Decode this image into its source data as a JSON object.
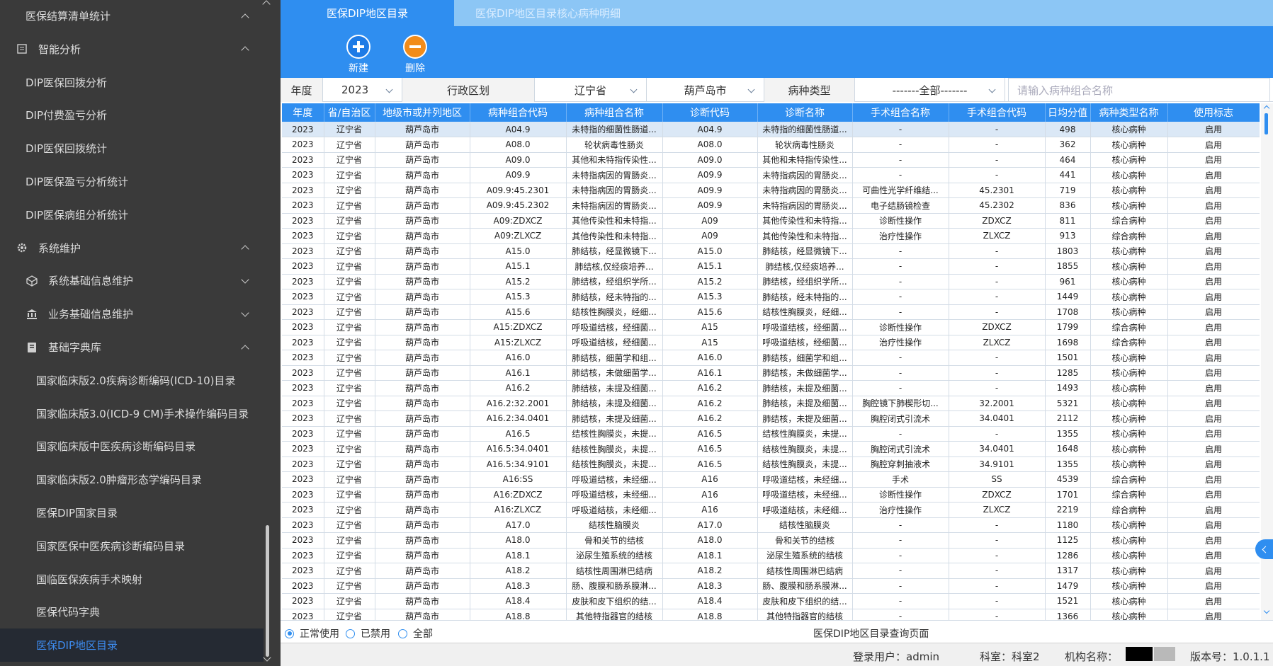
{
  "sidebar": {
    "items": [
      {
        "label": "医保结算清单统计",
        "level": 2,
        "chevron": "up"
      },
      {
        "label": "智能分析",
        "level": 1,
        "icon": "chart-doc-icon",
        "chevron": "up"
      },
      {
        "label": "DIP医保回拨分析",
        "level": 2
      },
      {
        "label": "DIP付费盈亏分析",
        "level": 2
      },
      {
        "label": "DIP医保回拨统计",
        "level": 2
      },
      {
        "label": "DIP医保盈亏分析统计",
        "level": 2
      },
      {
        "label": "DIP医保病组分析统计",
        "level": 2
      },
      {
        "label": "系统维护",
        "level": 1,
        "icon": "gear-icon",
        "chevron": "up"
      },
      {
        "label": "系统基础信息维护",
        "level": "1b",
        "icon": "cube-icon",
        "chevron": "down"
      },
      {
        "label": "业务基础信息维护",
        "level": "1b",
        "icon": "bank-icon",
        "chevron": "down"
      },
      {
        "label": "基础字典库",
        "level": "1b",
        "icon": "book-icon",
        "chevron": "up"
      },
      {
        "label": "国家临床版2.0疾病诊断编码(ICD-10)目录",
        "level": 3
      },
      {
        "label": "国家临床版3.0(ICD-9 CM)手术操作编码目录",
        "level": 3
      },
      {
        "label": "国家临床版中医疾病诊断编码目录",
        "level": 3
      },
      {
        "label": "国家临床版2.0肿瘤形态学编码目录",
        "level": 3
      },
      {
        "label": "医保DIP国家目录",
        "level": 3
      },
      {
        "label": "国家医保中医疾病诊断编码目录",
        "level": 3
      },
      {
        "label": "国临医保疾病手术映射",
        "level": 3
      },
      {
        "label": "医保代码字典",
        "level": 3
      },
      {
        "label": "医保DIP地区目录",
        "level": 3,
        "active": true
      }
    ]
  },
  "tabs": [
    {
      "label": "医保DIP地区目录",
      "active": true
    },
    {
      "label": "医保DIP地区目录核心病种明细",
      "active": false
    }
  ],
  "toolbar": {
    "new_label": "新建",
    "delete_label": "删除"
  },
  "filters": {
    "year_label": "年度",
    "year_value": "2023",
    "region_label": "行政区划",
    "province_value": "辽宁省",
    "city_value": "葫芦岛市",
    "type_label": "病种类型",
    "type_value": "-------全部-------",
    "search_placeholder": "请输入病种组合名称"
  },
  "table": {
    "headers": [
      "年度",
      "省/自治区",
      "地级市或并列地区",
      "病种组合代码",
      "病种组合名称",
      "诊断代码",
      "诊断名称",
      "手术组合名称",
      "手术组合代码",
      "日均分值",
      "病种类型名称",
      "使用标志"
    ],
    "rows": [
      [
        "2023",
        "辽宁省",
        "葫芦岛市",
        "A04.9",
        "未特指的细菌性肠道...",
        "A04.9",
        "未特指的细菌性肠道...",
        "-",
        "-",
        "498",
        "核心病种",
        "启用"
      ],
      [
        "2023",
        "辽宁省",
        "葫芦岛市",
        "A08.0",
        "轮状病毒性肠炎",
        "A08.0",
        "轮状病毒性肠炎",
        "-",
        "-",
        "362",
        "核心病种",
        "启用"
      ],
      [
        "2023",
        "辽宁省",
        "葫芦岛市",
        "A09.0",
        "其他和未特指传染性...",
        "A09.0",
        "其他和未特指传染性...",
        "-",
        "-",
        "464",
        "核心病种",
        "启用"
      ],
      [
        "2023",
        "辽宁省",
        "葫芦岛市",
        "A09.9",
        "未特指病因的胃肠炎...",
        "A09.9",
        "未特指病因的胃肠炎...",
        "-",
        "-",
        "441",
        "核心病种",
        "启用"
      ],
      [
        "2023",
        "辽宁省",
        "葫芦岛市",
        "A09.9:45.2301",
        "未特指病因的胃肠炎...",
        "A09.9",
        "未特指病因的胃肠炎...",
        "可曲性光学纤维结...",
        "45.2301",
        "719",
        "核心病种",
        "启用"
      ],
      [
        "2023",
        "辽宁省",
        "葫芦岛市",
        "A09.9:45.2302",
        "未特指病因的胃肠炎...",
        "A09.9",
        "未特指病因的胃肠炎...",
        "电子结肠镜检查",
        "45.2302",
        "836",
        "核心病种",
        "启用"
      ],
      [
        "2023",
        "辽宁省",
        "葫芦岛市",
        "A09:ZDXCZ",
        "其他传染性和未特指...",
        "A09",
        "其他传染性和未特指...",
        "诊断性操作",
        "ZDXCZ",
        "811",
        "综合病种",
        "启用"
      ],
      [
        "2023",
        "辽宁省",
        "葫芦岛市",
        "A09:ZLXCZ",
        "其他传染性和未特指...",
        "A09",
        "其他传染性和未特指...",
        "治疗性操作",
        "ZLXCZ",
        "913",
        "综合病种",
        "启用"
      ],
      [
        "2023",
        "辽宁省",
        "葫芦岛市",
        "A15.0",
        "肺结核，经显微镜下...",
        "A15.0",
        "肺结核，经显微镜下...",
        "-",
        "-",
        "1803",
        "核心病种",
        "启用"
      ],
      [
        "2023",
        "辽宁省",
        "葫芦岛市",
        "A15.1",
        "肺结核,仅经痰培养...",
        "A15.1",
        "肺结核,仅经痰培养...",
        "-",
        "-",
        "1855",
        "核心病种",
        "启用"
      ],
      [
        "2023",
        "辽宁省",
        "葫芦岛市",
        "A15.2",
        "肺结核，经组织学所...",
        "A15.2",
        "肺结核，经组织学所...",
        "-",
        "-",
        "961",
        "核心病种",
        "启用"
      ],
      [
        "2023",
        "辽宁省",
        "葫芦岛市",
        "A15.3",
        "肺结核，经未特指的...",
        "A15.3",
        "肺结核，经未特指的...",
        "-",
        "-",
        "1449",
        "核心病种",
        "启用"
      ],
      [
        "2023",
        "辽宁省",
        "葫芦岛市",
        "A15.6",
        "结核性胸膜炎，经细...",
        "A15.6",
        "结核性胸膜炎，经细...",
        "-",
        "-",
        "1708",
        "核心病种",
        "启用"
      ],
      [
        "2023",
        "辽宁省",
        "葫芦岛市",
        "A15:ZDXCZ",
        "呼吸道结核，经细菌...",
        "A15",
        "呼吸道结核，经细菌...",
        "诊断性操作",
        "ZDXCZ",
        "1799",
        "综合病种",
        "启用"
      ],
      [
        "2023",
        "辽宁省",
        "葫芦岛市",
        "A15:ZLXCZ",
        "呼吸道结核，经细菌...",
        "A15",
        "呼吸道结核，经细菌...",
        "治疗性操作",
        "ZLXCZ",
        "1698",
        "综合病种",
        "启用"
      ],
      [
        "2023",
        "辽宁省",
        "葫芦岛市",
        "A16.0",
        "肺结核，细菌学和组...",
        "A16.0",
        "肺结核，细菌学和组...",
        "-",
        "-",
        "1501",
        "核心病种",
        "启用"
      ],
      [
        "2023",
        "辽宁省",
        "葫芦岛市",
        "A16.1",
        "肺结核，未做细菌学...",
        "A16.1",
        "肺结核，未做细菌学...",
        "-",
        "-",
        "1285",
        "核心病种",
        "启用"
      ],
      [
        "2023",
        "辽宁省",
        "葫芦岛市",
        "A16.2",
        "肺结核，未提及细菌...",
        "A16.2",
        "肺结核，未提及细菌...",
        "-",
        "-",
        "1493",
        "核心病种",
        "启用"
      ],
      [
        "2023",
        "辽宁省",
        "葫芦岛市",
        "A16.2:32.2001",
        "肺结核，未提及细菌...",
        "A16.2",
        "肺结核，未提及细菌...",
        "胸腔镜下肺楔形切...",
        "32.2001",
        "5321",
        "核心病种",
        "启用"
      ],
      [
        "2023",
        "辽宁省",
        "葫芦岛市",
        "A16.2:34.0401",
        "肺结核，未提及细菌...",
        "A16.2",
        "肺结核，未提及细菌...",
        "胸腔闭式引流术",
        "34.0401",
        "2112",
        "核心病种",
        "启用"
      ],
      [
        "2023",
        "辽宁省",
        "葫芦岛市",
        "A16.5",
        "结核性胸膜炎，未提...",
        "A16.5",
        "结核性胸膜炎，未提...",
        "-",
        "-",
        "1355",
        "核心病种",
        "启用"
      ],
      [
        "2023",
        "辽宁省",
        "葫芦岛市",
        "A16.5:34.0401",
        "结核性胸膜炎，未提...",
        "A16.5",
        "结核性胸膜炎，未提...",
        "胸腔闭式引流术",
        "34.0401",
        "1648",
        "核心病种",
        "启用"
      ],
      [
        "2023",
        "辽宁省",
        "葫芦岛市",
        "A16.5:34.9101",
        "结核性胸膜炎，未提...",
        "A16.5",
        "结核性胸膜炎，未提...",
        "胸腔穿刺抽液术",
        "34.9101",
        "1355",
        "核心病种",
        "启用"
      ],
      [
        "2023",
        "辽宁省",
        "葫芦岛市",
        "A16:SS",
        "呼吸道结核，未经细...",
        "A16",
        "呼吸道结核，未经细...",
        "手术",
        "SS",
        "4539",
        "综合病种",
        "启用"
      ],
      [
        "2023",
        "辽宁省",
        "葫芦岛市",
        "A16:ZDXCZ",
        "呼吸道结核，未经细...",
        "A16",
        "呼吸道结核，未经细...",
        "诊断性操作",
        "ZDXCZ",
        "1701",
        "综合病种",
        "启用"
      ],
      [
        "2023",
        "辽宁省",
        "葫芦岛市",
        "A16:ZLXCZ",
        "呼吸道结核，未经细...",
        "A16",
        "呼吸道结核，未经细...",
        "治疗性操作",
        "ZLXCZ",
        "2219",
        "综合病种",
        "启用"
      ],
      [
        "2023",
        "辽宁省",
        "葫芦岛市",
        "A17.0",
        "结核性脑膜炎",
        "A17.0",
        "结核性脑膜炎",
        "-",
        "-",
        "1180",
        "核心病种",
        "启用"
      ],
      [
        "2023",
        "辽宁省",
        "葫芦岛市",
        "A18.0",
        "骨和关节的结核",
        "A18.0",
        "骨和关节的结核",
        "-",
        "-",
        "1125",
        "核心病种",
        "启用"
      ],
      [
        "2023",
        "辽宁省",
        "葫芦岛市",
        "A18.1",
        "泌尿生殖系统的结核",
        "A18.1",
        "泌尿生殖系统的结核",
        "-",
        "-",
        "1286",
        "核心病种",
        "启用"
      ],
      [
        "2023",
        "辽宁省",
        "葫芦岛市",
        "A18.2",
        "结核性周围淋巴结病",
        "A18.2",
        "结核性周围淋巴结病",
        "-",
        "-",
        "1317",
        "核心病种",
        "启用"
      ],
      [
        "2023",
        "辽宁省",
        "葫芦岛市",
        "A18.3",
        "肠、腹膜和肠系膜淋...",
        "A18.3",
        "肠、腹膜和肠系膜淋...",
        "-",
        "-",
        "1479",
        "核心病种",
        "启用"
      ],
      [
        "2023",
        "辽宁省",
        "葫芦岛市",
        "A18.4",
        "皮肤和皮下组织的结...",
        "A18.4",
        "皮肤和皮下组织的结...",
        "-",
        "-",
        "1521",
        "核心病种",
        "启用"
      ],
      [
        "2023",
        "辽宁省",
        "葫芦岛市",
        "A18.8",
        "其他特指器官的结核",
        "A18.8",
        "其他特指器官的结核",
        "-",
        "-",
        "1366",
        "核心病种",
        "启用"
      ]
    ]
  },
  "status_filter": {
    "options": [
      {
        "label": "正常使用",
        "checked": true
      },
      {
        "label": "已禁用",
        "checked": false
      },
      {
        "label": "全部",
        "checked": false
      }
    ],
    "caption": "医保DIP地区目录查询页面"
  },
  "statusbar": {
    "user": "登录用户：admin",
    "dept": "科室：科室2",
    "org_label": "机构名称：",
    "version": "版本号：1.0.1.1"
  },
  "colors": {
    "accent": "#2f8ef0",
    "sidebar_bg": "#3a3a3a",
    "tab_bar": "#8cc6f5"
  }
}
